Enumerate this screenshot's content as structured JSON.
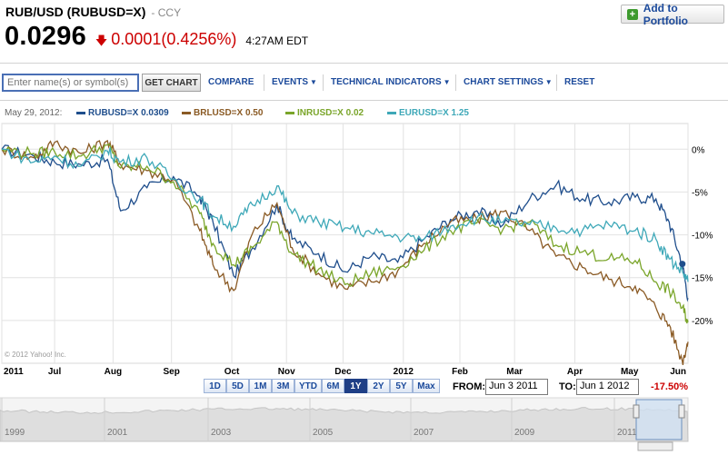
{
  "header": {
    "title": "RUB/USD (RUBUSD=X)",
    "ccy": "CCY",
    "price": "0.0296",
    "change": "0.0001(0.4256%)",
    "time": "4:27AM EDT",
    "change_color": "#cc0000"
  },
  "portfolio": {
    "label": "Add to Portfolio"
  },
  "toolbar": {
    "search_placeholder": "Enter name(s) or symbol(s)",
    "get_chart": "GET CHART",
    "compare": "COMPARE",
    "events": "EVENTS",
    "technical": "TECHNICAL INDICATORS",
    "settings": "CHART SETTINGS",
    "reset": "RESET"
  },
  "legend": {
    "date": "May 29, 2012:",
    "items": [
      {
        "label": "RUBUSD=X 0.0309",
        "color": "#1f4e8c"
      },
      {
        "label": "BRLUSD=X 0.50",
        "color": "#8a5a24"
      },
      {
        "label": "INRUSD=X 0.02",
        "color": "#7aa52a"
      },
      {
        "label": "EURUSD=X 1.25",
        "color": "#3ea8b8"
      }
    ]
  },
  "copyright": "© 2012 Yahoo! Inc.",
  "range": {
    "buttons": [
      "1D",
      "5D",
      "1M",
      "3M",
      "YTD",
      "6M",
      "1Y",
      "2Y",
      "5Y",
      "Max"
    ],
    "active": "1Y",
    "from_label": "FROM:",
    "from_value": "Jun 3 2011",
    "to_label": "TO:",
    "to_value": "Jun 1 2012",
    "pct_change": "-17.50%"
  },
  "chart_data": {
    "type": "line",
    "title": "",
    "xlabel": "",
    "ylabel": "",
    "x_ticks": [
      "2011",
      "Jul",
      "Aug",
      "Sep",
      "Oct",
      "Nov",
      "Dec",
      "2012",
      "Feb",
      "Mar",
      "Apr",
      "May",
      "Jun"
    ],
    "y_ticks": [
      "0%",
      "-5%",
      "-10%",
      "-15%",
      "-20%"
    ],
    "ylim": [
      -25,
      3
    ],
    "xlim": [
      "2011-06-03",
      "2012-06-01"
    ],
    "grid": true,
    "series": [
      {
        "name": "RUBUSD=X",
        "color": "#1f4e8c",
        "x": [
          "2011-06-03",
          "2011-06-20",
          "2011-07-01",
          "2011-07-15",
          "2011-07-29",
          "2011-08-05",
          "2011-08-19",
          "2011-09-02",
          "2011-09-16",
          "2011-09-23",
          "2011-10-04",
          "2011-10-14",
          "2011-10-27",
          "2011-11-04",
          "2011-11-18",
          "2011-12-02",
          "2011-12-16",
          "2011-12-30",
          "2012-01-13",
          "2012-01-27",
          "2012-02-10",
          "2012-02-24",
          "2012-03-09",
          "2012-03-23",
          "2012-04-06",
          "2012-04-20",
          "2012-05-04",
          "2012-05-15",
          "2012-05-22",
          "2012-05-29",
          "2012-06-01"
        ],
        "values": [
          0,
          -0.8,
          -1.5,
          -1.8,
          -1.2,
          -7.2,
          -4.5,
          -3.2,
          -5.5,
          -8.5,
          -14.8,
          -11.5,
          -6.5,
          -10.5,
          -12.2,
          -14.3,
          -12.5,
          -13.2,
          -10.5,
          -8.2,
          -7.2,
          -8.8,
          -5.8,
          -4.2,
          -5.8,
          -6.2,
          -5.6,
          -5.8,
          -8.5,
          -13.4,
          -17.4
        ]
      },
      {
        "name": "BRLUSD=X",
        "color": "#8a5a24",
        "x": [
          "2011-06-03",
          "2011-06-20",
          "2011-07-01",
          "2011-07-15",
          "2011-07-29",
          "2011-08-05",
          "2011-08-19",
          "2011-09-02",
          "2011-09-16",
          "2011-09-23",
          "2011-10-04",
          "2011-10-14",
          "2011-10-27",
          "2011-11-04",
          "2011-11-18",
          "2011-12-02",
          "2011-12-16",
          "2011-12-30",
          "2012-01-13",
          "2012-01-27",
          "2012-02-10",
          "2012-02-24",
          "2012-03-09",
          "2012-03-23",
          "2012-04-06",
          "2012-04-20",
          "2012-05-04",
          "2012-05-15",
          "2012-05-22",
          "2012-05-29",
          "2012-06-01"
        ],
        "values": [
          0,
          -1.0,
          0.8,
          -0.5,
          1.0,
          -1.8,
          -2.5,
          -3.5,
          -9.5,
          -13.5,
          -16.5,
          -9.8,
          -6.3,
          -11.5,
          -14.5,
          -16.3,
          -15.5,
          -14.2,
          -11.0,
          -8.5,
          -8.2,
          -7.3,
          -9.5,
          -12.5,
          -13.8,
          -15.2,
          -16.0,
          -18.5,
          -20.5,
          -24.8,
          -22.5
        ]
      },
      {
        "name": "INRUSD=X",
        "color": "#7aa52a",
        "x": [
          "2011-06-03",
          "2011-06-20",
          "2011-07-01",
          "2011-07-15",
          "2011-07-29",
          "2011-08-05",
          "2011-08-19",
          "2011-09-02",
          "2011-09-16",
          "2011-09-23",
          "2011-10-04",
          "2011-10-14",
          "2011-10-27",
          "2011-11-04",
          "2011-11-18",
          "2011-12-02",
          "2011-12-16",
          "2011-12-30",
          "2012-01-13",
          "2012-01-27",
          "2012-02-10",
          "2012-02-24",
          "2012-03-09",
          "2012-03-23",
          "2012-04-06",
          "2012-04-20",
          "2012-05-04",
          "2012-05-15",
          "2012-05-22",
          "2012-05-29",
          "2012-06-01"
        ],
        "values": [
          0,
          -0.5,
          -0.3,
          -0.8,
          0.5,
          -2.2,
          -2.0,
          -3.8,
          -7.5,
          -11.0,
          -13.5,
          -11.5,
          -8.5,
          -12.2,
          -14.0,
          -15.8,
          -14.5,
          -13.8,
          -11.8,
          -9.5,
          -8.6,
          -9.3,
          -8.5,
          -11.2,
          -12.0,
          -12.8,
          -13.0,
          -15.5,
          -16.5,
          -18.5,
          -20.2
        ]
      },
      {
        "name": "EURUSD=X",
        "color": "#3ea8b8",
        "x": [
          "2011-06-03",
          "2011-06-20",
          "2011-07-01",
          "2011-07-15",
          "2011-07-29",
          "2011-08-05",
          "2011-08-19",
          "2011-09-02",
          "2011-09-16",
          "2011-09-23",
          "2011-10-04",
          "2011-10-14",
          "2011-10-27",
          "2011-11-04",
          "2011-11-18",
          "2011-12-02",
          "2011-12-16",
          "2011-12-30",
          "2012-01-13",
          "2012-01-27",
          "2012-02-10",
          "2012-02-24",
          "2012-03-09",
          "2012-03-23",
          "2012-04-06",
          "2012-04-20",
          "2012-05-04",
          "2012-05-15",
          "2012-05-22",
          "2012-05-29",
          "2012-06-01"
        ],
        "values": [
          0,
          -1.5,
          -0.8,
          -2.0,
          -0.2,
          -1.5,
          -1.0,
          -3.5,
          -5.8,
          -7.8,
          -9.0,
          -6.5,
          -4.3,
          -7.5,
          -8.5,
          -9.2,
          -9.8,
          -10.2,
          -10.5,
          -9.0,
          -8.0,
          -8.5,
          -8.8,
          -9.2,
          -9.5,
          -8.8,
          -9.5,
          -10.5,
          -12.8,
          -14.3,
          -15.5
        ]
      }
    ],
    "navigator": {
      "x_ticks": [
        "1999",
        "2001",
        "2003",
        "2005",
        "2007",
        "2009",
        "2011"
      ]
    }
  }
}
